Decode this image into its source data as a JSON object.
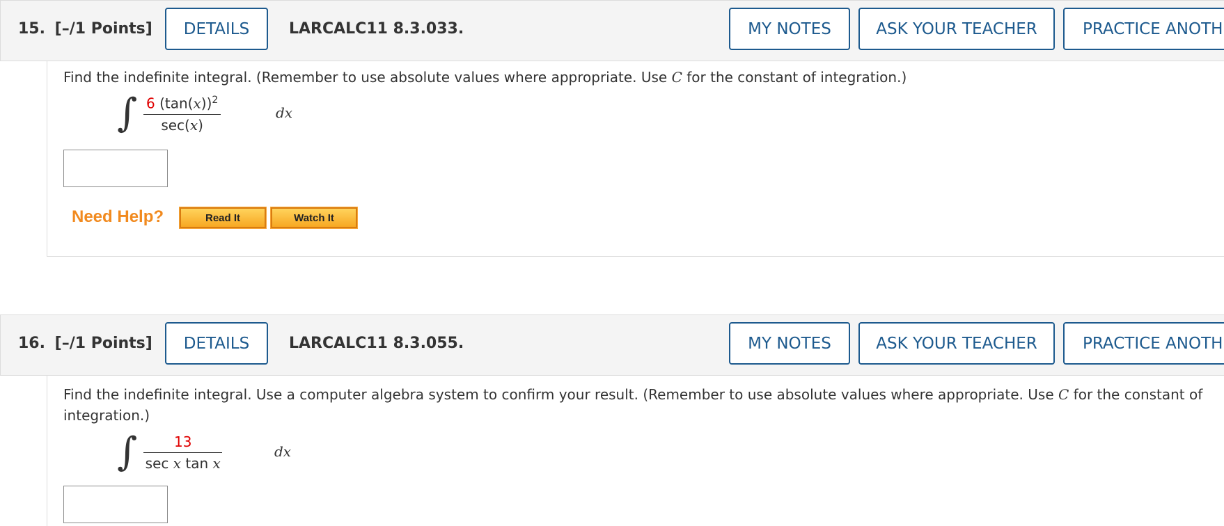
{
  "questions": [
    {
      "number": "15.",
      "points": "[–/1 Points]",
      "details_label": "DETAILS",
      "code": "LARCALC11 8.3.033.",
      "my_notes_label": "MY NOTES",
      "ask_label": "ASK YOUR TEACHER",
      "practice_label": "PRACTICE ANOTHER",
      "prompt_a": "Find the indefinite integral. (Remember to use absolute values where appropriate. Use ",
      "prompt_c": "C",
      "prompt_b": " for the constant of integration.)",
      "numerator_coef": "6",
      "numerator_rest_a": " (tan(",
      "numerator_var": "x",
      "numerator_rest_b": "))",
      "numerator_exp": "2",
      "denominator_a": "sec(",
      "denominator_var": "x",
      "denominator_b": ")",
      "dx": "dx",
      "answer_value": "",
      "need_help_label": "Need Help?",
      "read_it_label": "Read It",
      "watch_it_label": "Watch It"
    },
    {
      "number": "16.",
      "points": "[–/1 Points]",
      "details_label": "DETAILS",
      "code": "LARCALC11 8.3.055.",
      "my_notes_label": "MY NOTES",
      "ask_label": "ASK YOUR TEACHER",
      "practice_label": "PRACTICE ANOTHER",
      "prompt_a": "Find the indefinite integral. Use a computer algebra system to confirm your result. (Remember to use absolute values where appropriate. Use ",
      "prompt_c": "C",
      "prompt_b": " for the constant of integration.)",
      "numerator": "13",
      "denominator_a": "sec ",
      "denominator_var1": "x",
      "denominator_b": " tan ",
      "denominator_var2": "x",
      "dx": "dx",
      "answer_value": ""
    }
  ],
  "colors": {
    "accent": "#1d5a8e",
    "red_coefficient": "#e00000",
    "need_help": "#f18a1f",
    "help_button": "#f7a823"
  }
}
